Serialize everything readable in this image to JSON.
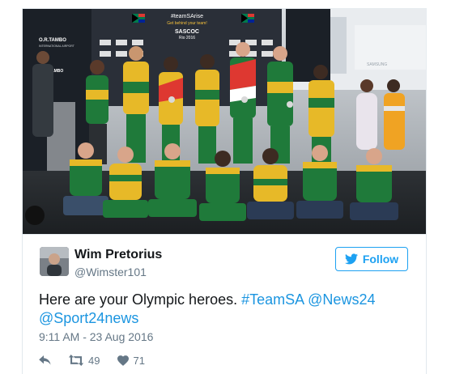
{
  "photo": {
    "backdrop_hashtag": "#teamSArise",
    "backdrop_tagline": "Get behind your team!",
    "backdrop_org": "SASCOC",
    "backdrop_event": "Rio 2016",
    "airport_logo": "O.R.TAMBO",
    "airport_sub": "INTERNATIONAL AIRPORT",
    "brand_text": "SAMSUNG"
  },
  "tweet": {
    "display_name": "Wim Pretorius",
    "handle": "@Wimster101",
    "follow_label": "Follow",
    "text_plain": "Here are your Olympic heroes. ",
    "text_hashtag": "#TeamSA",
    "text_space": " ",
    "text_mention1": "@News24",
    "text_mention2": "@Sport24news",
    "timestamp": "9:11 AM - 23 Aug 2016",
    "retweets": "49",
    "likes": "71"
  },
  "colors": {
    "accent": "#1da1f2",
    "link": "#1b95e0",
    "text": "#14171a",
    "muted": "#657786",
    "jersey_green": "#1f7a3a",
    "jersey_gold": "#e7b928"
  },
  "icons": [
    "twitter-bird-icon",
    "reply-icon",
    "retweet-icon",
    "heart-icon"
  ]
}
